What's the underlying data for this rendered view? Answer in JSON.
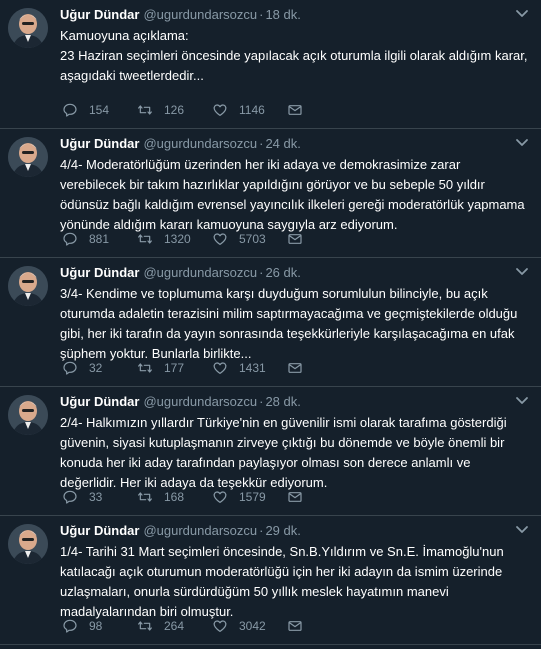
{
  "tweets": [
    {
      "name": "Uğur Dündar",
      "handle": "@ugurdundarsozcu",
      "time": "18 dk.",
      "text": "Kamuoyuna açıklama:\n23 Haziran seçimleri öncesinde yapılacak açık oturumla ilgili olarak aldığım karar, aşagıdaki tweetlerdedir...",
      "replies": "154",
      "retweets": "126",
      "likes": "1146"
    },
    {
      "name": "Uğur Dündar",
      "handle": "@ugurdundarsozcu",
      "time": "24 dk.",
      "text": "4/4- Moderatörlüğüm üzerinden her iki adaya ve demokrasimize zarar verebilecek bir takım hazırlıklar yapıldığını görüyor ve bu sebeple 50 yıldır ödünsüz bağlı kaldığım evrensel yayıncılık ilkeleri gereği moderatörlük yapmama yönünde aldığım kararı kamuoyuna saygıyla arz ediyorum.",
      "replies": "881",
      "retweets": "1320",
      "likes": "5703"
    },
    {
      "name": "Uğur Dündar",
      "handle": "@ugurdundarsozcu",
      "time": "26 dk.",
      "text": "3/4- Kendime ve toplumuma karşı duyduğum sorumlulun bilinciyle, bu açık oturumda adaletin terazisini milim saptırmayacağıma ve geçmiştekilerde olduğu gibi, her iki tarafın da yayın sonrasında teşekkürleriyle karşılaşacağıma en ufak şüphem yoktur. Bunlarla birlikte...",
      "replies": "32",
      "retweets": "177",
      "likes": "1431"
    },
    {
      "name": "Uğur Dündar",
      "handle": "@ugurdundarsozcu",
      "time": "28 dk.",
      "text": "2/4- Halkımızın yıllardır Türkiye'nin en güvenilir ismi olarak tarafıma gösterdiği güvenin, siyasi kutuplaşmanın zirveye çıktığı bu dönemde ve böyle önemli bir konuda her iki aday tarafından paylaşıyor olması son derece anlamlı ve değerlidir. Her iki adaya da teşekkür ediyorum.",
      "replies": "33",
      "retweets": "168",
      "likes": "1579"
    },
    {
      "name": "Uğur Dündar",
      "handle": "@ugurdundarsozcu",
      "time": "29 dk.",
      "text": "1/4- Tarihi 31 Mart seçimleri öncesinde, Sn.B.Yıldırım ve Sn.E. İmamoğlu'nun katılacağı açık oturumun moderatörlüğü için her iki adayın da ismim üzerinde uzlaşmaları, onurla sürdürdüğüm 50 yıllık meslek hayatımın manevi madalyalarından biri olmuştur.",
      "replies": "98",
      "retweets": "264",
      "likes": "3042"
    }
  ],
  "icons": {
    "reply": "reply-icon",
    "retweet": "retweet-icon",
    "like": "heart-icon",
    "dm": "envelope-icon",
    "menu": "chevron-down-icon"
  },
  "colors": {
    "background": "#15202b",
    "secondary_text": "#8899a6",
    "divider": "#38444d"
  }
}
